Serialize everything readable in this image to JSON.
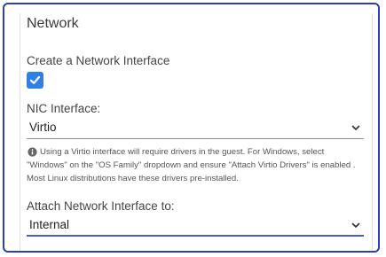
{
  "panel": {
    "title": "Network"
  },
  "create_interface": {
    "label": "Create a Network Interface",
    "checked": true
  },
  "nic_interface": {
    "label": "NIC Interface:",
    "value": "Virtio"
  },
  "info": {
    "icon": "info-icon",
    "text": "Using a Virtio interface will require drivers in the guest. For Windows, select \"Windows\" on the \"OS Family\" dropdown and ensure \"Attach Virtio Drivers\" is enabled . Most Linux distributions have these drivers pre-installed."
  },
  "attach_to": {
    "label": "Attach Network Interface to:",
    "value": "Internal"
  },
  "colors": {
    "accent": "#2e80e8",
    "frame_border": "#2a3fb0",
    "active_underline": "#4a5bd0"
  }
}
